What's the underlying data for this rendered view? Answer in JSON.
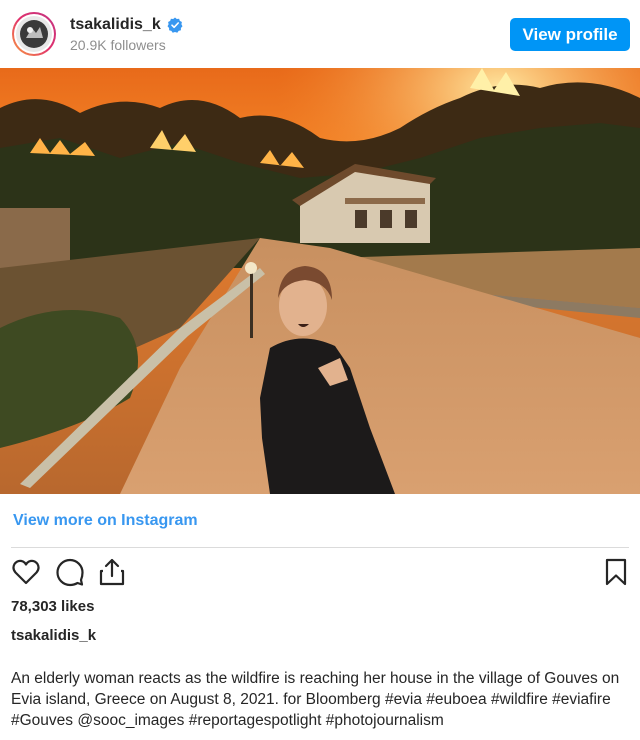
{
  "header": {
    "username": "tsakalidis_k",
    "followers": "20.9K followers",
    "view_profile_label": "View profile"
  },
  "photo": {
    "icon": "wildfire-photo"
  },
  "links": {
    "view_more": "View more on Instagram"
  },
  "actions": {
    "icons": [
      "heart-icon",
      "comment-icon",
      "share-icon",
      "bookmark-icon"
    ]
  },
  "post": {
    "likes": "78,303 likes",
    "caption_username": "tsakalidis_k",
    "caption_text": "An elderly woman reacts as the wildfire is reaching her house in the village of Gouves on Evia island, Greece on August 8, 2021. for Bloomberg #evia #euboea #wildfire #eviafire #Gouves @sooc_images #reportagespotlight #photojournalism"
  },
  "colors": {
    "accent": "#0095f6",
    "link": "#3897f0",
    "text": "#262626",
    "muted": "#8e8e8e"
  }
}
